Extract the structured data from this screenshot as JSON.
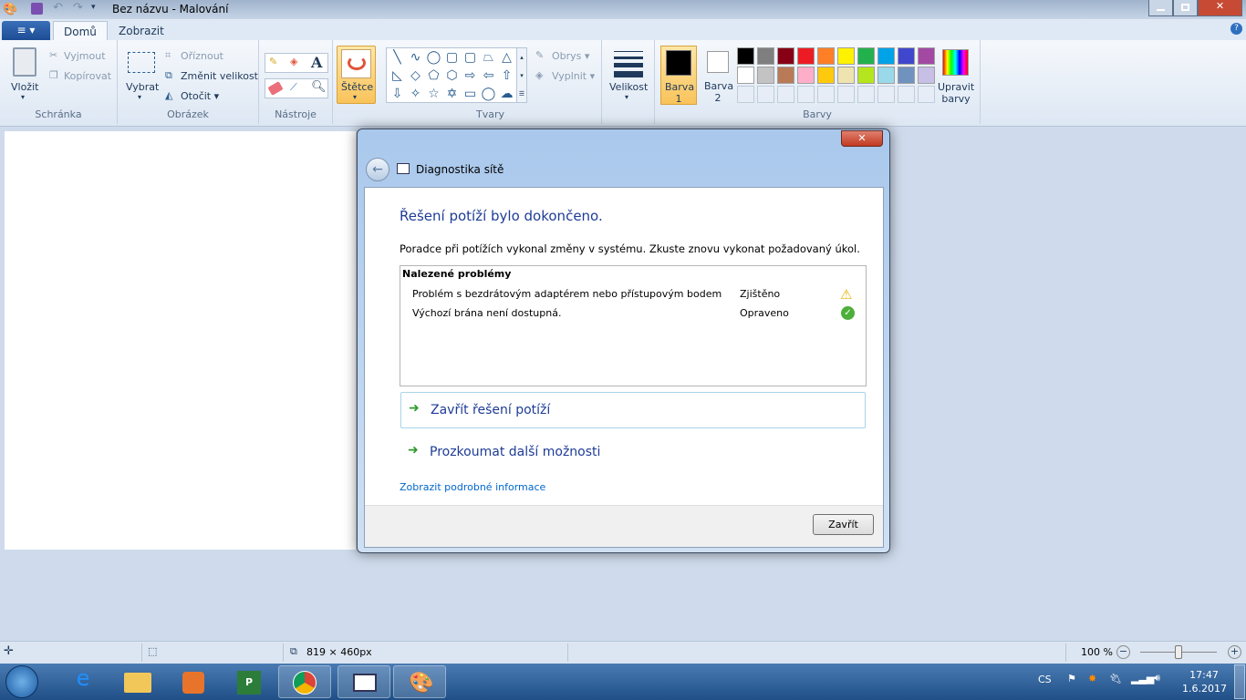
{
  "window": {
    "title": "Bez názvu - Malování"
  },
  "tabs": {
    "file": "≡ ▾",
    "home": "Domů",
    "view": "Zobrazit"
  },
  "ribbon": {
    "clipboard": {
      "group": "Schránka",
      "paste": "Vložit",
      "cut": "Vyjmout",
      "copy": "Kopírovat"
    },
    "image": {
      "group": "Obrázek",
      "select": "Vybrat",
      "crop": "Oříznout",
      "resize": "Změnit velikost",
      "rotate": "Otočit ▾"
    },
    "tools": {
      "group": "Nástroje",
      "text_glyph": "A"
    },
    "brushes": {
      "label": "Štětce"
    },
    "shapes": {
      "group": "Tvary",
      "outline": "Obrys ▾",
      "fill": "Vyplnit ▾",
      "glyphs": [
        "╲",
        "∿",
        "◯",
        "▢",
        "▢",
        "⏢",
        "△",
        "◺",
        "◇",
        "⬠",
        "⬡",
        "⇨",
        "⇦",
        "⇧",
        "⇩",
        "✧",
        "☆",
        "✡",
        "▭",
        "◯",
        "☁"
      ]
    },
    "size": {
      "label": "Velikost"
    },
    "colors": {
      "group": "Barvy",
      "color1": "Barva 1",
      "color2": "Barva 2",
      "edit": "Upravit barvy",
      "palette": [
        "#000000",
        "#7f7f7f",
        "#880015",
        "#ed1c24",
        "#ff7f27",
        "#fff200",
        "#22b14c",
        "#00a2e8",
        "#3f48cc",
        "#a349a4",
        "#ffffff",
        "#c3c3c3",
        "#b97a57",
        "#ffaec9",
        "#ffc90e",
        "#efe4b0",
        "#b5e61d",
        "#99d9ea",
        "#7092be",
        "#c8bfe7"
      ],
      "color1_value": "#000000",
      "color2_value": "#ffffff"
    }
  },
  "dialog": {
    "title": "Diagnostika sítě",
    "heading": "Řešení potíží bylo dokončeno.",
    "description": "Poradce při potížích vykonal změny v systému. Zkuste znovu vykonat požadovaný úkol.",
    "problems_header": "Nalezené problémy",
    "problems": [
      {
        "name": "Problém s bezdrátovým adaptérem nebo přístupovým bodem",
        "status": "Zjištěno",
        "icon": "warning-icon"
      },
      {
        "name": "Výchozí brána není dostupná.",
        "status": "Opraveno",
        "icon": "check-icon"
      }
    ],
    "close_troubleshooting": "Zavřít řešení potíží",
    "explore_options": "Prozkoumat další možnosti",
    "details_link": "Zobrazit podrobné informace",
    "close_button": "Zavřít"
  },
  "statusbar": {
    "canvas_size": "819 × 460px",
    "zoom": "100 %",
    "zoom_value": 100
  },
  "taskbar": {
    "language": "CS",
    "time": "17:47",
    "date": "1.6.2017"
  }
}
